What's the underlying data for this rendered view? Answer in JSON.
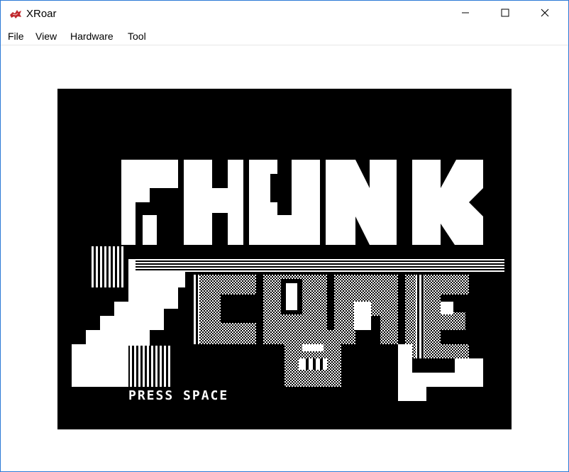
{
  "window": {
    "title": "XRoar",
    "controls": [
      "minimize",
      "maximize",
      "close"
    ]
  },
  "menu": {
    "items": [
      {
        "label": "File"
      },
      {
        "label": "View"
      },
      {
        "label": "Hardware"
      },
      {
        "label": "Tool"
      }
    ]
  },
  "screen": {
    "title_text": "CHUNK ZONE",
    "prompt": "PRESS SPACE",
    "background": "#000000",
    "foreground": "#ffffff"
  },
  "icons": {
    "app": "xroar-dragon-icon",
    "minimize": "minimize-icon",
    "maximize": "maximize-icon",
    "close": "close-icon"
  }
}
